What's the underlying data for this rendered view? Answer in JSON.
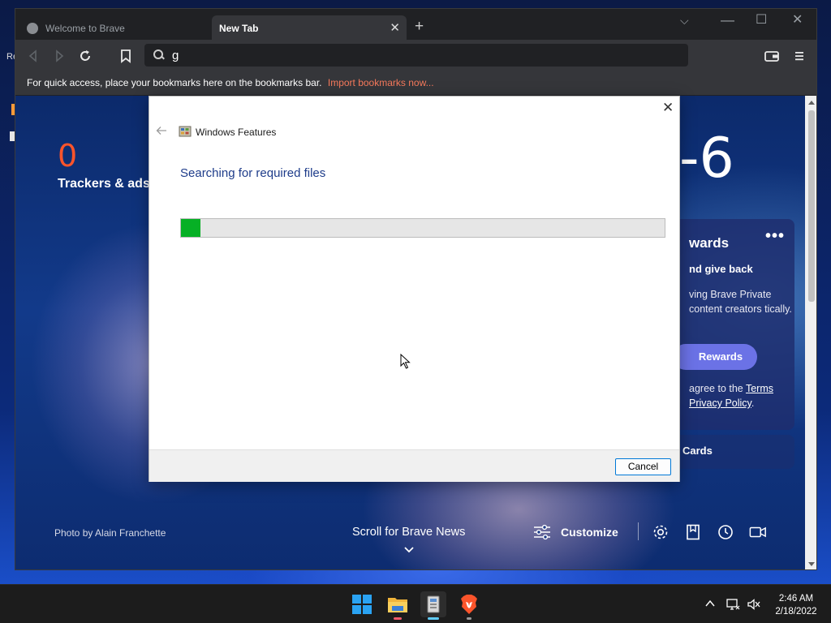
{
  "desktop": {
    "label": "Re"
  },
  "browser": {
    "tabs": [
      {
        "title": "Welcome to Brave",
        "active": false
      },
      {
        "title": "New Tab",
        "active": true
      }
    ],
    "omnibox_value": "g",
    "bookmarks_bar": {
      "message": "For quick access, place your bookmarks here on the bookmarks bar.",
      "import_link": "Import bookmarks now..."
    }
  },
  "ntp": {
    "trackers_count": "0",
    "trackers_label": "Trackers & ads",
    "time_display": "-6",
    "rewards": {
      "title": "wards",
      "subtitle": "nd give back",
      "body": "ving Brave Private content creators tically.",
      "button_label": "Rewards",
      "terms_prefix": "agree to the",
      "terms_link": "Terms",
      "privacy_link": "Privacy Policy"
    },
    "cards_label": "Cards",
    "photo_credit": "Photo by Alain Franchette",
    "scroll_news": "Scroll for Brave News",
    "customize_label": "Customize"
  },
  "dialog": {
    "title": "Windows Features",
    "heading": "Searching for required files",
    "progress_fraction": 0.04,
    "cancel_label": "Cancel"
  },
  "taskbar": {
    "time": "2:46 AM",
    "date": "2/18/2022"
  },
  "colors": {
    "brave_orange": "#fb542b",
    "progress_green": "#06b025",
    "rewards_button": "#6b72e6",
    "dialog_heading": "#1e3c8a"
  }
}
